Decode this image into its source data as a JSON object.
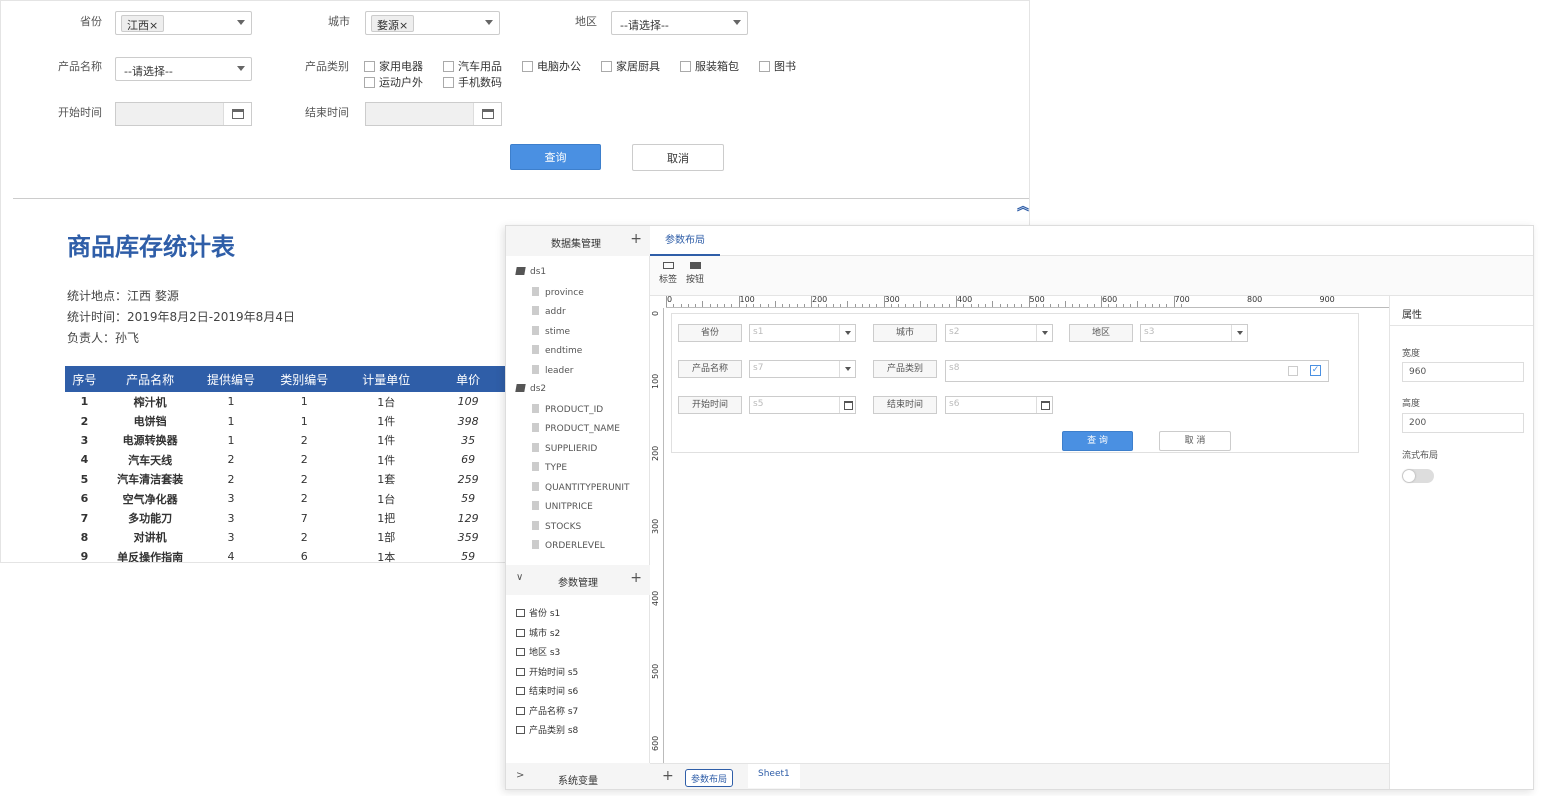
{
  "params": {
    "province_label": "省份",
    "province_tag": "江西",
    "tag_remove": "×",
    "city_label": "城市",
    "city_tag": "婺源",
    "district_label": "地区",
    "district_placeholder": "--请选择--",
    "product_name_label": "产品名称",
    "product_name_placeholder": "--请选择--",
    "product_type_label": "产品类别",
    "categories": [
      "家用电器",
      "汽车用品",
      "电脑办公",
      "家居厨具",
      "服装箱包",
      "图书",
      "运动户外",
      "手机数码"
    ],
    "start_label": "开始时间",
    "end_label": "结束时间",
    "query": "查询",
    "cancel": "取消"
  },
  "report": {
    "title": "商品库存统计表",
    "location": "统计地点：江西 婺源",
    "time": "统计时间：2019年8月2日-2019年8月4日",
    "owner": "负责人：孙飞",
    "columns": [
      "序号",
      "产品名称",
      "提供编号",
      "类别编号",
      "计量单位",
      "单价"
    ],
    "rows": [
      [
        "1",
        "榨汁机",
        "1",
        "1",
        "1台",
        "109"
      ],
      [
        "2",
        "电饼铛",
        "1",
        "1",
        "1件",
        "398"
      ],
      [
        "3",
        "电源转换器",
        "1",
        "2",
        "1件",
        "35"
      ],
      [
        "4",
        "汽车天线",
        "2",
        "2",
        "1件",
        "69"
      ],
      [
        "5",
        "汽车清洁套装",
        "2",
        "2",
        "1套",
        "259"
      ],
      [
        "6",
        "空气净化器",
        "3",
        "2",
        "1台",
        "59"
      ],
      [
        "7",
        "多功能刀",
        "3",
        "7",
        "1把",
        "129"
      ],
      [
        "8",
        "对讲机",
        "3",
        "2",
        "1部",
        "359"
      ],
      [
        "9",
        "单反操作指南",
        "4",
        "6",
        "1本",
        "59"
      ]
    ]
  },
  "designer": {
    "dataset_panel": "数据集管理",
    "plus": "+",
    "ds1": "ds1",
    "ds1_fields": [
      "province",
      "addr",
      "stime",
      "endtime",
      "leader"
    ],
    "ds2": "ds2",
    "ds2_fields": [
      "PRODUCT_ID",
      "PRODUCT_NAME",
      "SUPPLIERID",
      "TYPE",
      "QUANTITYPERUNIT",
      "UNITPRICE",
      "STOCKS",
      "ORDERLEVEL"
    ],
    "param_panel": "参数管理",
    "chevron_down": "∨",
    "chevron_right": ">",
    "param_items": [
      "省份 s1",
      "城市 s2",
      "地区 s3",
      "开始时间 s5",
      "结束时间 s6",
      "产品名称 s7",
      "产品类别 s8"
    ],
    "sysvar_panel": "系统变量",
    "tab": "参数布局",
    "tool_label": "标签",
    "tool_button": "按钮",
    "ruler_x": [
      "0",
      "100",
      "200",
      "300",
      "400",
      "500",
      "600",
      "700",
      "800",
      "900"
    ],
    "ruler_y": [
      "0",
      "100",
      "200",
      "300",
      "400",
      "500",
      "600"
    ],
    "layout": {
      "province": "省份",
      "s1": "s1",
      "city": "城市",
      "s2": "s2",
      "district": "地区",
      "s3": "s3",
      "pname": "产品名称",
      "s7": "s7",
      "ptype": "产品类别",
      "s8": "s8",
      "start": "开始时间",
      "s5": "s5",
      "end": "结束时间",
      "s6": "s6",
      "query": "查 询",
      "cancel": "取 消"
    },
    "props": {
      "title": "属性",
      "width_label": "宽度",
      "width": "960",
      "height_label": "高度",
      "height": "200",
      "flow_label": "流式布局"
    },
    "sheet_tabs": [
      "参数布局",
      "Sheet1"
    ]
  }
}
